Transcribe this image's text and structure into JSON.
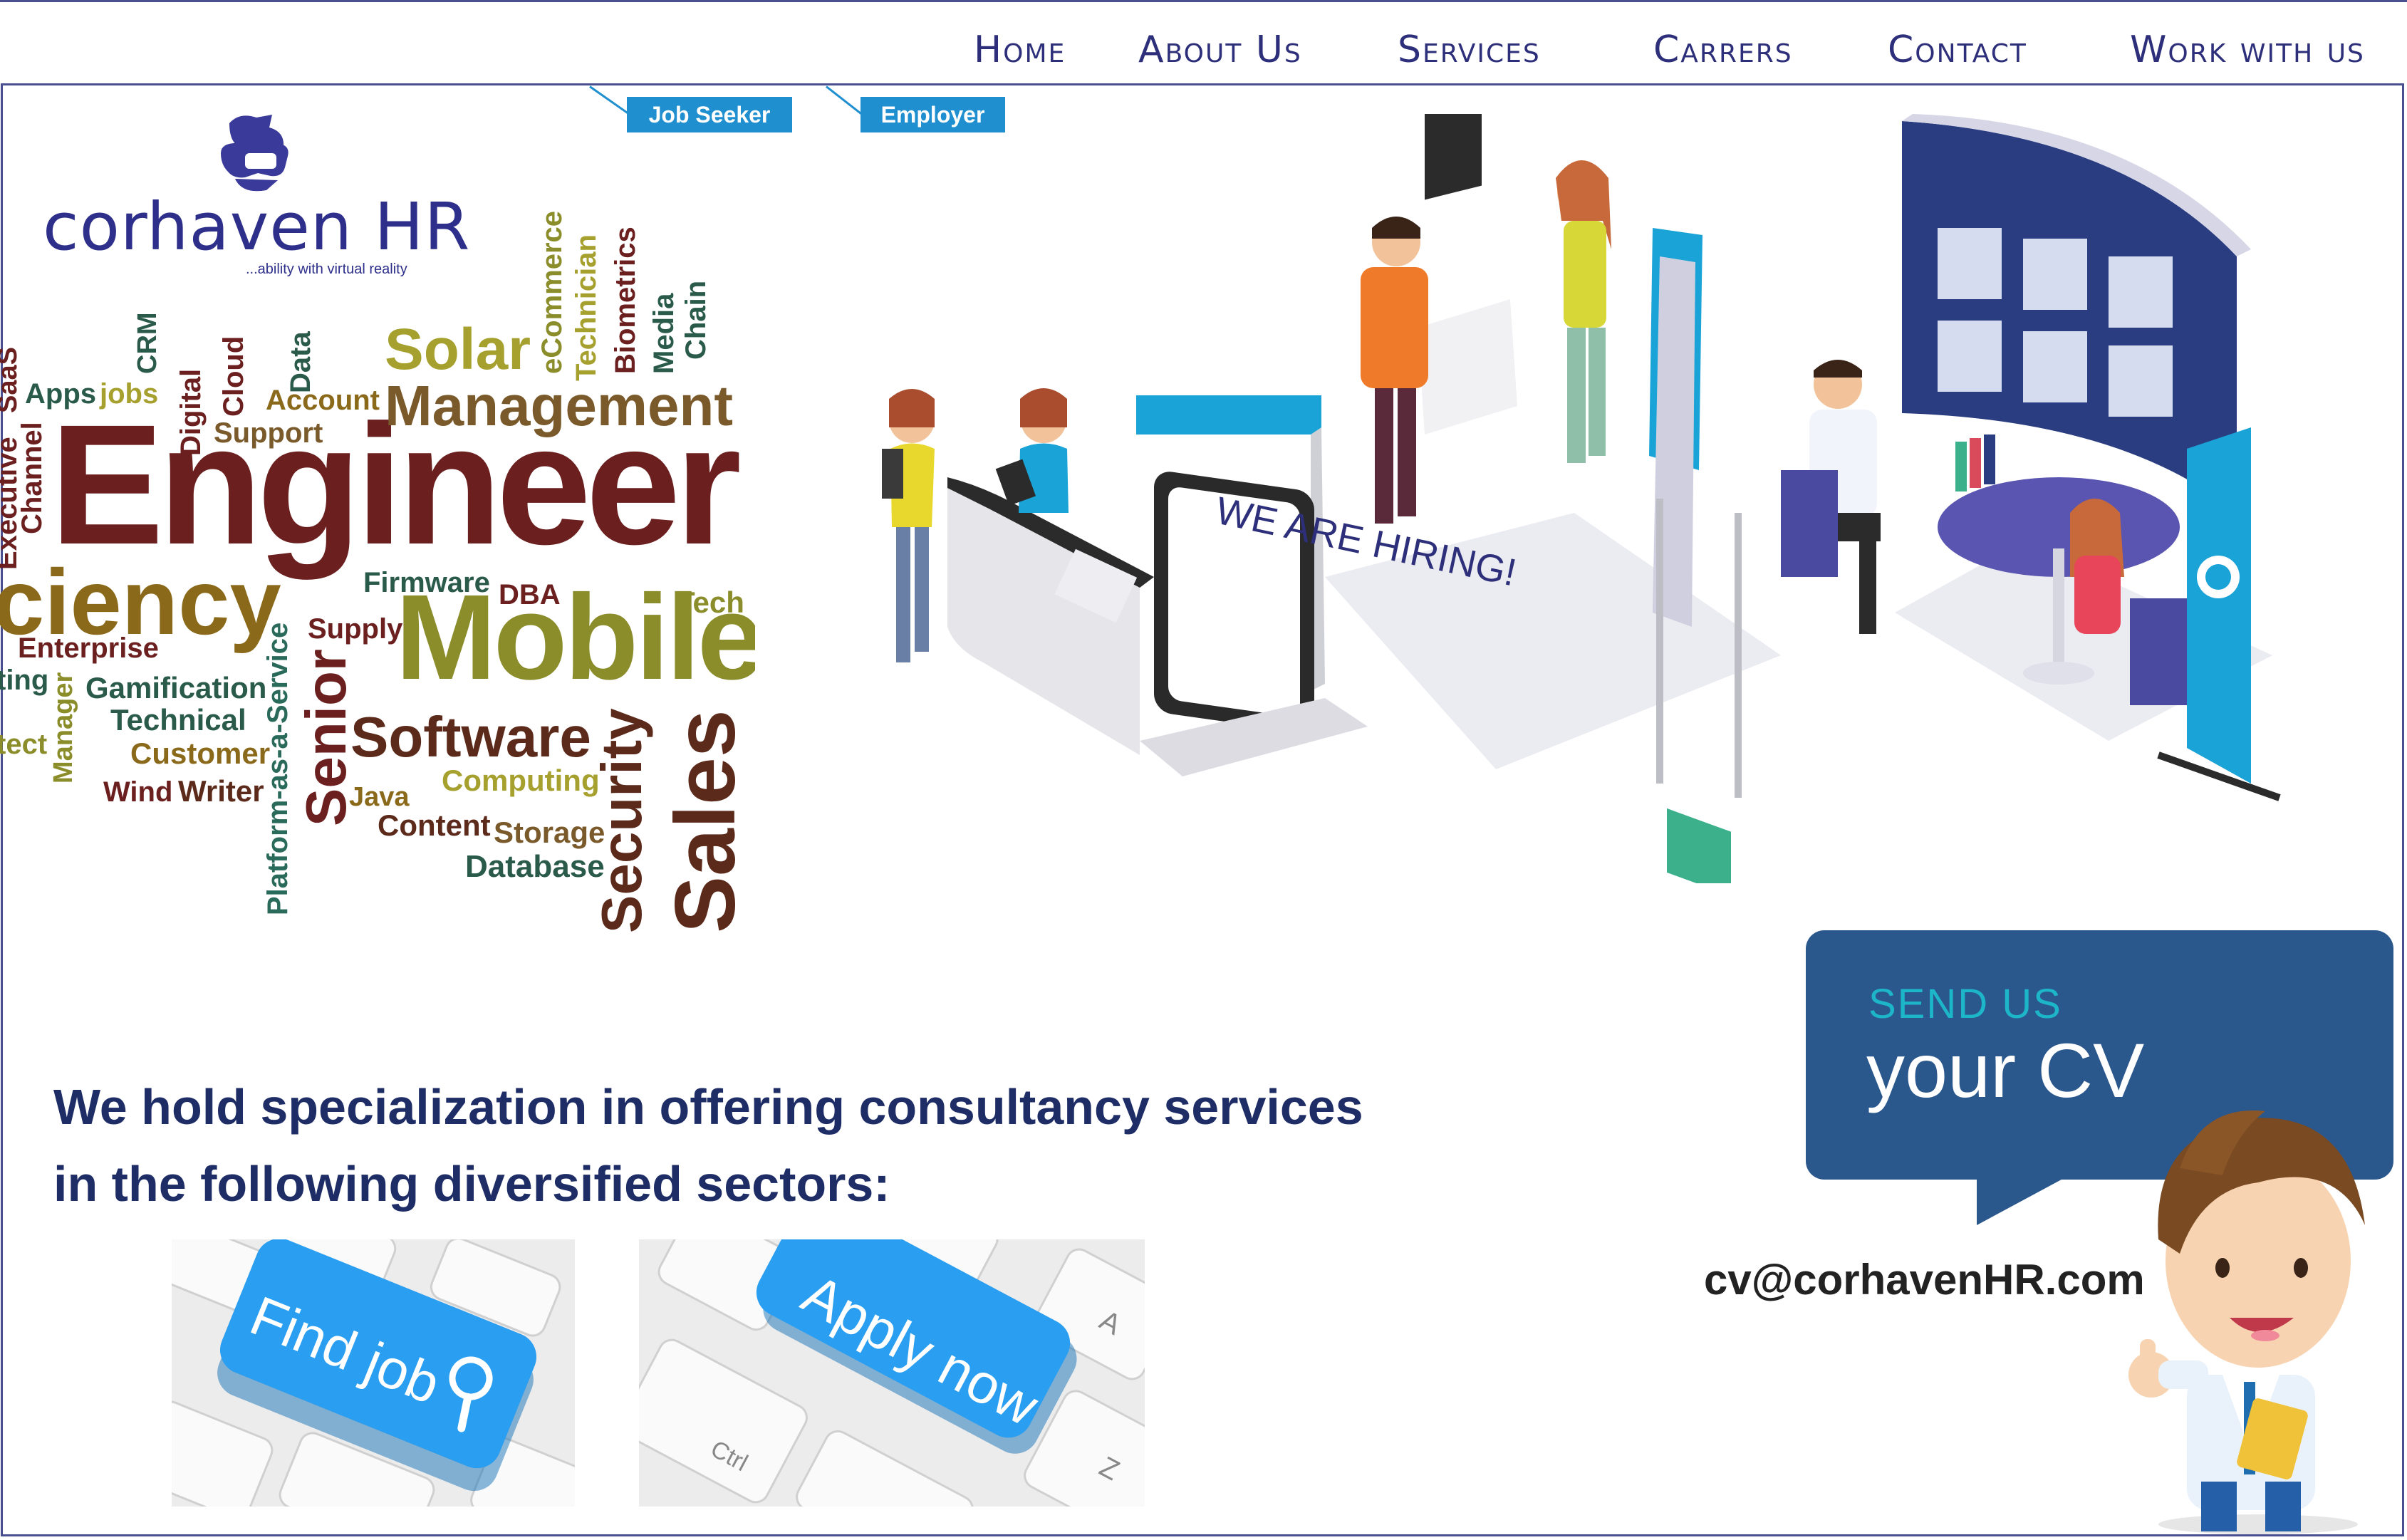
{
  "nav": {
    "items": [
      "Home",
      "About Us",
      "Services",
      "Carrers",
      "Contact",
      "Work with us"
    ]
  },
  "tabs": {
    "job_seeker": "Job Seeker",
    "employer": "Employer"
  },
  "logo": {
    "name": "corhaven HR",
    "tagline": "...ability with virtual reality"
  },
  "word_cloud": {
    "engineer": "Engineer",
    "mobile": "Mobile",
    "management": "Management",
    "solar": "Solar",
    "software": "Software",
    "sales": "Sales",
    "security": "Security",
    "senior": "Senior",
    "efficiency": "ciency",
    "platform": "Platform-as-a-Service",
    "enterprise": "Enterprise",
    "gamification": "Gamification",
    "technical": "Technical",
    "customer": "Customer",
    "writer": "Writer",
    "wind": "Wind",
    "java": "Java",
    "computing": "Computing",
    "content": "Content",
    "storage": "Storage",
    "database": "Database",
    "firmware": "Firmware",
    "dba": "DBA",
    "tech": "Tech",
    "supply": "Supply",
    "account": "Account",
    "support": "Support",
    "apps": "Apps",
    "jobs": "jobs",
    "digital": "Digital",
    "cloud": "Cloud",
    "crm": "CRM",
    "data": "Data",
    "ecommerce": "eCommerce",
    "technician": "Technician",
    "biometrics": "Biometrics",
    "media": "Media",
    "chain": "Chain",
    "executive": "Executive",
    "channel": "Channel",
    "saas": "SaaS",
    "manager": "Manager",
    "ting": "ting",
    "tect": "tect"
  },
  "scene": {
    "sign_text": "WE ARE HIRING!"
  },
  "main": {
    "headline_line1": "We hold specialization in offering consultancy services",
    "headline_line2": "in the following diversified sectors:"
  },
  "buttons": {
    "find_job": "Find job",
    "apply_now": "Apply now",
    "key_ctrl": "Ctrl",
    "key_a": "A",
    "key_z": "Z"
  },
  "cv": {
    "line1": "SEND US",
    "line2": "your CV",
    "email": "cv@corhavenHR.com"
  },
  "colors": {
    "brand_navy": "#2d2f7a",
    "accent_blue": "#1f8fd0",
    "cv_blue": "#2a578c",
    "cv_teal": "#1db6c9"
  }
}
